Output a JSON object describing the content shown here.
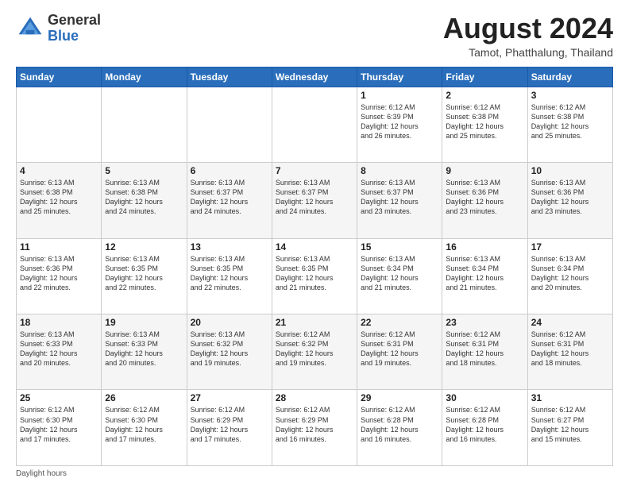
{
  "header": {
    "logo_general": "General",
    "logo_blue": "Blue",
    "month_title": "August 2024",
    "subtitle": "Tamot, Phatthalung, Thailand"
  },
  "days_of_week": [
    "Sunday",
    "Monday",
    "Tuesday",
    "Wednesday",
    "Thursday",
    "Friday",
    "Saturday"
  ],
  "weeks": [
    [
      {
        "day": "",
        "info": ""
      },
      {
        "day": "",
        "info": ""
      },
      {
        "day": "",
        "info": ""
      },
      {
        "day": "",
        "info": ""
      },
      {
        "day": "1",
        "info": "Sunrise: 6:12 AM\nSunset: 6:39 PM\nDaylight: 12 hours\nand 26 minutes."
      },
      {
        "day": "2",
        "info": "Sunrise: 6:12 AM\nSunset: 6:38 PM\nDaylight: 12 hours\nand 25 minutes."
      },
      {
        "day": "3",
        "info": "Sunrise: 6:12 AM\nSunset: 6:38 PM\nDaylight: 12 hours\nand 25 minutes."
      }
    ],
    [
      {
        "day": "4",
        "info": "Sunrise: 6:13 AM\nSunset: 6:38 PM\nDaylight: 12 hours\nand 25 minutes."
      },
      {
        "day": "5",
        "info": "Sunrise: 6:13 AM\nSunset: 6:38 PM\nDaylight: 12 hours\nand 24 minutes."
      },
      {
        "day": "6",
        "info": "Sunrise: 6:13 AM\nSunset: 6:37 PM\nDaylight: 12 hours\nand 24 minutes."
      },
      {
        "day": "7",
        "info": "Sunrise: 6:13 AM\nSunset: 6:37 PM\nDaylight: 12 hours\nand 24 minutes."
      },
      {
        "day": "8",
        "info": "Sunrise: 6:13 AM\nSunset: 6:37 PM\nDaylight: 12 hours\nand 23 minutes."
      },
      {
        "day": "9",
        "info": "Sunrise: 6:13 AM\nSunset: 6:36 PM\nDaylight: 12 hours\nand 23 minutes."
      },
      {
        "day": "10",
        "info": "Sunrise: 6:13 AM\nSunset: 6:36 PM\nDaylight: 12 hours\nand 23 minutes."
      }
    ],
    [
      {
        "day": "11",
        "info": "Sunrise: 6:13 AM\nSunset: 6:36 PM\nDaylight: 12 hours\nand 22 minutes."
      },
      {
        "day": "12",
        "info": "Sunrise: 6:13 AM\nSunset: 6:35 PM\nDaylight: 12 hours\nand 22 minutes."
      },
      {
        "day": "13",
        "info": "Sunrise: 6:13 AM\nSunset: 6:35 PM\nDaylight: 12 hours\nand 22 minutes."
      },
      {
        "day": "14",
        "info": "Sunrise: 6:13 AM\nSunset: 6:35 PM\nDaylight: 12 hours\nand 21 minutes."
      },
      {
        "day": "15",
        "info": "Sunrise: 6:13 AM\nSunset: 6:34 PM\nDaylight: 12 hours\nand 21 minutes."
      },
      {
        "day": "16",
        "info": "Sunrise: 6:13 AM\nSunset: 6:34 PM\nDaylight: 12 hours\nand 21 minutes."
      },
      {
        "day": "17",
        "info": "Sunrise: 6:13 AM\nSunset: 6:34 PM\nDaylight: 12 hours\nand 20 minutes."
      }
    ],
    [
      {
        "day": "18",
        "info": "Sunrise: 6:13 AM\nSunset: 6:33 PM\nDaylight: 12 hours\nand 20 minutes."
      },
      {
        "day": "19",
        "info": "Sunrise: 6:13 AM\nSunset: 6:33 PM\nDaylight: 12 hours\nand 20 minutes."
      },
      {
        "day": "20",
        "info": "Sunrise: 6:13 AM\nSunset: 6:32 PM\nDaylight: 12 hours\nand 19 minutes."
      },
      {
        "day": "21",
        "info": "Sunrise: 6:12 AM\nSunset: 6:32 PM\nDaylight: 12 hours\nand 19 minutes."
      },
      {
        "day": "22",
        "info": "Sunrise: 6:12 AM\nSunset: 6:31 PM\nDaylight: 12 hours\nand 19 minutes."
      },
      {
        "day": "23",
        "info": "Sunrise: 6:12 AM\nSunset: 6:31 PM\nDaylight: 12 hours\nand 18 minutes."
      },
      {
        "day": "24",
        "info": "Sunrise: 6:12 AM\nSunset: 6:31 PM\nDaylight: 12 hours\nand 18 minutes."
      }
    ],
    [
      {
        "day": "25",
        "info": "Sunrise: 6:12 AM\nSunset: 6:30 PM\nDaylight: 12 hours\nand 17 minutes."
      },
      {
        "day": "26",
        "info": "Sunrise: 6:12 AM\nSunset: 6:30 PM\nDaylight: 12 hours\nand 17 minutes."
      },
      {
        "day": "27",
        "info": "Sunrise: 6:12 AM\nSunset: 6:29 PM\nDaylight: 12 hours\nand 17 minutes."
      },
      {
        "day": "28",
        "info": "Sunrise: 6:12 AM\nSunset: 6:29 PM\nDaylight: 12 hours\nand 16 minutes."
      },
      {
        "day": "29",
        "info": "Sunrise: 6:12 AM\nSunset: 6:28 PM\nDaylight: 12 hours\nand 16 minutes."
      },
      {
        "day": "30",
        "info": "Sunrise: 6:12 AM\nSunset: 6:28 PM\nDaylight: 12 hours\nand 16 minutes."
      },
      {
        "day": "31",
        "info": "Sunrise: 6:12 AM\nSunset: 6:27 PM\nDaylight: 12 hours\nand 15 minutes."
      }
    ]
  ],
  "footer": {
    "note": "Daylight hours"
  }
}
